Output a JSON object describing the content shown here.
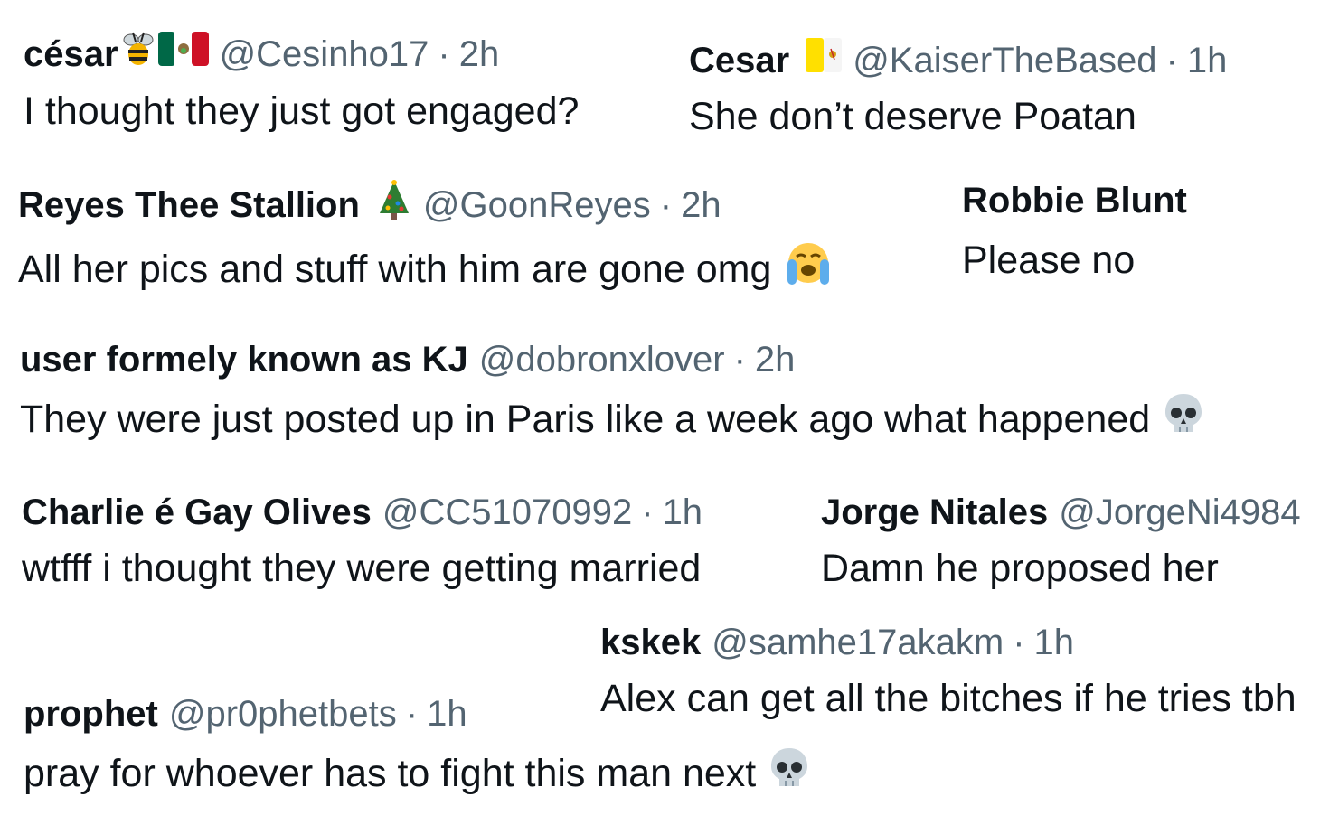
{
  "replies": [
    {
      "name": "césar",
      "handle": "@Cesinho17",
      "sep": "·",
      "time": "2h",
      "text": "I thought they just got engaged?",
      "name_emojis": [
        "bee-emoji",
        "mexico-flag-emoji"
      ]
    },
    {
      "name": "Cesar",
      "handle": "@KaiserTheBased",
      "sep": "·",
      "time": "1h",
      "text": "She don’t deserve Poatan",
      "name_emojis": [
        "vatican-flag-emoji"
      ]
    },
    {
      "name": "Reyes Thee Stallion",
      "handle": "@GoonReyes",
      "sep": "·",
      "time": "2h",
      "text": "All her pics and stuff with him are gone omg",
      "name_emojis": [
        "christmas-tree-emoji"
      ],
      "text_emojis": [
        "crying-face-emoji"
      ]
    },
    {
      "name": "Robbie Blunt",
      "text": "Please no"
    },
    {
      "name": "user formely known as KJ",
      "handle": "@dobronxlover",
      "sep": "·",
      "time": "2h",
      "text": "They were just posted up in Paris like a week ago what happened",
      "text_emojis": [
        "skull-emoji"
      ]
    },
    {
      "name": "Charlie é Gay Olives",
      "handle": "@CC51070992",
      "sep": "·",
      "time": "1h",
      "text": "wtfff i thought they were getting married"
    },
    {
      "name": "Jorge Nitales",
      "handle": "@JorgeNi4984",
      "text": "Damn he proposed her"
    },
    {
      "name": "kskek",
      "handle": "@samhe17akakm",
      "sep": "·",
      "time": "1h",
      "text": "Alex can get all the bitches if he tries tbh"
    },
    {
      "name": "prophet",
      "handle": "@pr0phetbets",
      "sep": "·",
      "time": "1h",
      "text": "pray for whoever has to fight this man next",
      "text_emojis": [
        "skull-emoji"
      ]
    }
  ]
}
